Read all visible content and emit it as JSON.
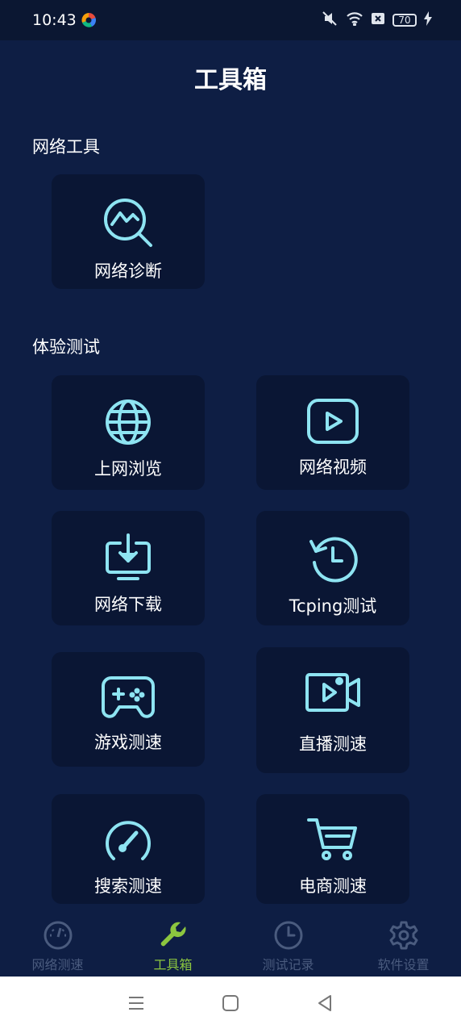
{
  "status": {
    "time": "10:43",
    "battery": "70"
  },
  "page_title": "工具箱",
  "sections": {
    "network_tools": "网络工具",
    "experience_tests": "体验测试"
  },
  "cards": {
    "diagnosis": "网络诊断",
    "browse": "上网浏览",
    "video": "网络视频",
    "download": "网络下载",
    "tcping": "Tcping测试",
    "game": "游戏测速",
    "live": "直播测速",
    "search": "搜索测速",
    "ecommerce": "电商测速"
  },
  "nav": {
    "items": [
      {
        "label": "网络测速",
        "icon": "speedometer-icon"
      },
      {
        "label": "工具箱",
        "icon": "wrench-icon"
      },
      {
        "label": "测试记录",
        "icon": "clock-icon"
      },
      {
        "label": "软件设置",
        "icon": "gear-icon"
      }
    ],
    "active_index": 1
  },
  "colors": {
    "background": "#0e1e44",
    "card": "#0a1634",
    "icon": "#8ee4f2",
    "accent": "#8cc63f",
    "nav_inactive": "#4a5b7e"
  }
}
